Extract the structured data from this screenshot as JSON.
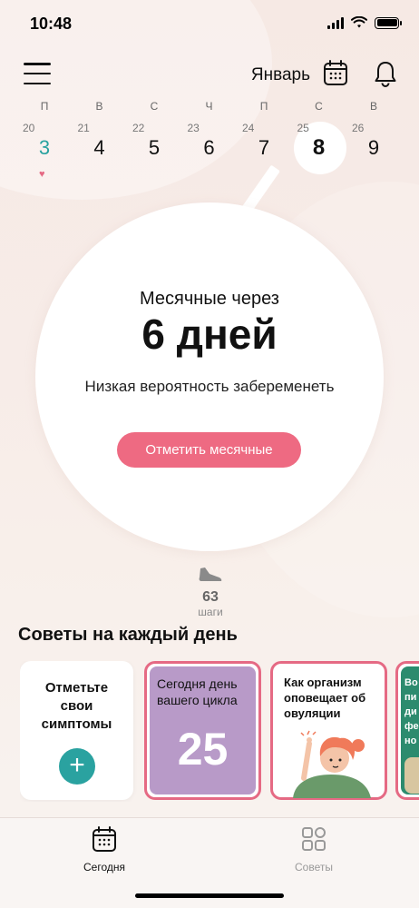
{
  "status_bar": {
    "time": "10:48"
  },
  "header": {
    "month": "Январь"
  },
  "week": [
    {
      "letter": "П",
      "date_small": "20",
      "day_num": "3",
      "today": true,
      "selected": false,
      "heart": true
    },
    {
      "letter": "В",
      "date_small": "21",
      "day_num": "4",
      "today": false,
      "selected": false,
      "heart": false
    },
    {
      "letter": "С",
      "date_small": "22",
      "day_num": "5",
      "today": false,
      "selected": false,
      "heart": false
    },
    {
      "letter": "Ч",
      "date_small": "23",
      "day_num": "6",
      "today": false,
      "selected": false,
      "heart": false
    },
    {
      "letter": "П",
      "date_small": "24",
      "day_num": "7",
      "today": false,
      "selected": false,
      "heart": false
    },
    {
      "letter": "С",
      "date_small": "25",
      "day_num": "8",
      "today": false,
      "selected": true,
      "heart": false
    },
    {
      "letter": "В",
      "date_small": "26",
      "day_num": "9",
      "today": false,
      "selected": false,
      "heart": false
    }
  ],
  "main": {
    "period_in": "Месячные через",
    "period_days": "6 дней",
    "probability": "Низкая вероятность забеременеть",
    "log_period_button": "Отметить месячные"
  },
  "steps": {
    "count": "63",
    "label": "шаги"
  },
  "tips": {
    "title": "Советы на каждый день",
    "cards": {
      "symptoms": "Отметьте свои симптомы",
      "cycle_text": "Сегодня день вашего цикла",
      "cycle_day": "25",
      "ovulation_text": "Как организм оповещает об овуляции",
      "next_text": "Во пи ди фе но"
    }
  },
  "tabbar": {
    "today": "Сегодня",
    "tips": "Советы"
  },
  "colors": {
    "accent_pink": "#ee6a82",
    "teal": "#2aa2a0",
    "purple": "#b89ac8"
  }
}
